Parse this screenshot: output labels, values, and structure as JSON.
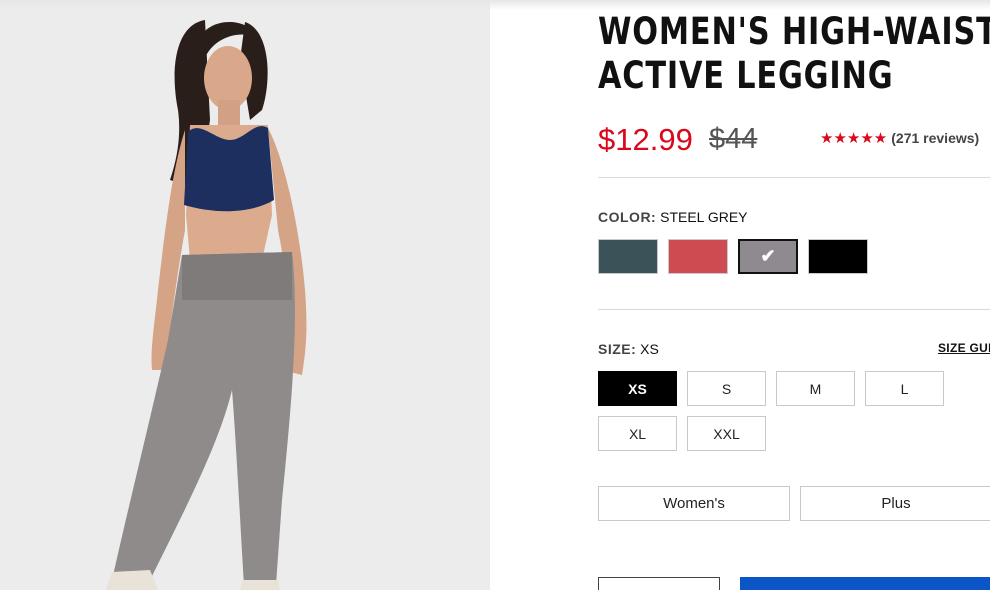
{
  "product": {
    "title_line1": "WOMEN'S HIGH-WAIST",
    "title_line2": "ACTIVE LEGGING",
    "sale_price": "$12.99",
    "original_price": "$44",
    "rating": 5,
    "stars": "★★★★★",
    "review_count_text": "(271 reviews)"
  },
  "color": {
    "label": "COLOR:",
    "selected": "STEEL GREY",
    "swatches": [
      {
        "name": "Slate Teal",
        "hex": "#3b5358"
      },
      {
        "name": "Coral Red",
        "hex": "#cf4b52"
      },
      {
        "name": "Steel Grey",
        "hex": "#8e8a8f",
        "selected": true
      },
      {
        "name": "Black",
        "hex": "#000000"
      }
    ],
    "check_glyph": "✔"
  },
  "size": {
    "label": "SIZE:",
    "selected": "XS",
    "guide_label": "SIZE GUIDE",
    "options": [
      "XS",
      "S",
      "M",
      "L",
      "XL",
      "XXL"
    ]
  },
  "fit": {
    "options": [
      "Women's",
      "Plus"
    ]
  },
  "colors": {
    "sale_red": "#d8091d",
    "primary_blue": "#0b55c6",
    "image_bg": "#ececec"
  }
}
